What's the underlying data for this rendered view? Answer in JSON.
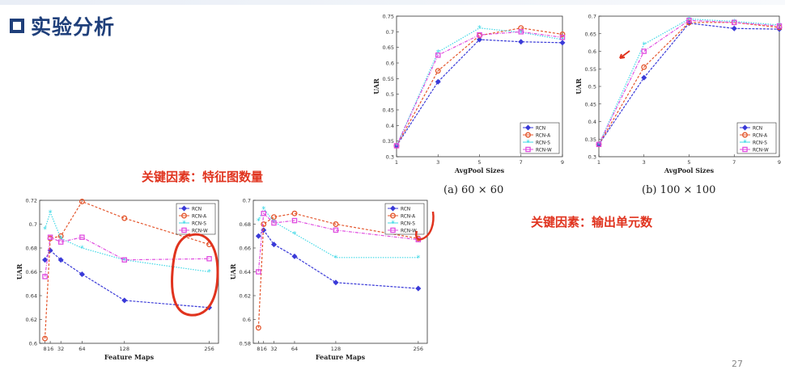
{
  "slide": {
    "title": "实验分析",
    "note_left": "关键因素：特征图数量",
    "note_right": "关键因素：输出单元数",
    "caption_a": "(a) 60 × 60",
    "caption_b": "(b) 100 × 100",
    "page_number": "27"
  },
  "colors": {
    "RCN": "#3a3ad8",
    "RCN-A": "#e4572e",
    "RCN-S": "#3fd8e6",
    "RCN-W": "#e04ee0",
    "title": "#1f3f7a",
    "annotation": "#e0331e"
  },
  "chart_data": [
    {
      "id": "pool60",
      "type": "line",
      "title": "",
      "xlabel": "AvgPool Sizes",
      "ylabel": "UAR",
      "x": [
        1,
        3,
        5,
        7,
        9
      ],
      "xticks": [
        1,
        3,
        5,
        7,
        9
      ],
      "xlim": [
        1,
        9
      ],
      "ylim": [
        0.3,
        0.75
      ],
      "yticks": [
        0.3,
        0.35,
        0.4,
        0.45,
        0.5,
        0.55,
        0.6,
        0.65,
        0.7,
        0.75
      ],
      "legend_position": "bottom-right",
      "series": [
        {
          "name": "RCN",
          "values": [
            0.335,
            0.54,
            0.675,
            0.668,
            0.665
          ]
        },
        {
          "name": "RCN-A",
          "values": [
            0.335,
            0.575,
            0.688,
            0.712,
            0.692
          ]
        },
        {
          "name": "RCN-S",
          "values": [
            0.335,
            0.635,
            0.712,
            0.698,
            0.675
          ]
        },
        {
          "name": "RCN-W",
          "values": [
            0.335,
            0.625,
            0.69,
            0.7,
            0.682
          ]
        }
      ]
    },
    {
      "id": "pool100",
      "type": "line",
      "title": "",
      "xlabel": "AvgPool Sizes",
      "ylabel": "UAR",
      "x": [
        1,
        3,
        5,
        7,
        9
      ],
      "xticks": [
        1,
        3,
        5,
        7,
        9
      ],
      "xlim": [
        1,
        9
      ],
      "ylim": [
        0.3,
        0.7
      ],
      "yticks": [
        0.3,
        0.35,
        0.4,
        0.45,
        0.5,
        0.55,
        0.6,
        0.65,
        0.7
      ],
      "legend_position": "bottom-right",
      "series": [
        {
          "name": "RCN",
          "values": [
            0.335,
            0.525,
            0.68,
            0.665,
            0.663
          ]
        },
        {
          "name": "RCN-A",
          "values": [
            0.335,
            0.555,
            0.682,
            0.682,
            0.668
          ]
        },
        {
          "name": "RCN-S",
          "values": [
            0.335,
            0.62,
            0.692,
            0.685,
            0.675
          ]
        },
        {
          "name": "RCN-W",
          "values": [
            0.335,
            0.6,
            0.688,
            0.682,
            0.672
          ]
        }
      ]
    },
    {
      "id": "fm1",
      "type": "line",
      "title": "",
      "xlabel": "Feature Maps",
      "ylabel": "UAR",
      "x": [
        8,
        16,
        32,
        64,
        128,
        256
      ],
      "xticks": [
        8,
        16,
        32,
        64,
        128,
        256
      ],
      "xlim": [
        0,
        270
      ],
      "ylim": [
        0.6,
        0.72
      ],
      "yticks": [
        0.6,
        0.62,
        0.64,
        0.66,
        0.68,
        0.7,
        0.72
      ],
      "legend_position": "top-right",
      "series": [
        {
          "name": "RCN",
          "values": [
            0.67,
            0.678,
            0.67,
            0.658,
            0.636,
            0.63
          ]
        },
        {
          "name": "RCN-A",
          "values": [
            0.604,
            0.688,
            0.69,
            0.719,
            0.705,
            0.683
          ]
        },
        {
          "name": "RCN-S",
          "values": [
            0.696,
            0.71,
            0.688,
            0.68,
            0.67,
            0.66
          ]
        },
        {
          "name": "RCN-W",
          "values": [
            0.656,
            0.689,
            0.685,
            0.689,
            0.67,
            0.671
          ]
        }
      ]
    },
    {
      "id": "fm2",
      "type": "line",
      "title": "",
      "xlabel": "Feature Maps",
      "ylabel": "UAR",
      "x": [
        8,
        16,
        32,
        64,
        128,
        256
      ],
      "xticks": [
        8,
        16,
        32,
        64,
        128,
        256
      ],
      "xlim": [
        0,
        270
      ],
      "ylim": [
        0.58,
        0.7
      ],
      "yticks": [
        0.58,
        0.6,
        0.62,
        0.64,
        0.66,
        0.68,
        0.7
      ],
      "legend_position": "top-right",
      "series": [
        {
          "name": "RCN",
          "values": [
            0.67,
            0.675,
            0.663,
            0.653,
            0.631,
            0.626
          ]
        },
        {
          "name": "RCN-A",
          "values": [
            0.593,
            0.68,
            0.686,
            0.689,
            0.68,
            0.668
          ]
        },
        {
          "name": "RCN-S",
          "values": [
            0.683,
            0.693,
            0.682,
            0.672,
            0.652,
            0.652
          ]
        },
        {
          "name": "RCN-W",
          "values": [
            0.64,
            0.689,
            0.681,
            0.683,
            0.675,
            0.667
          ]
        }
      ]
    }
  ]
}
